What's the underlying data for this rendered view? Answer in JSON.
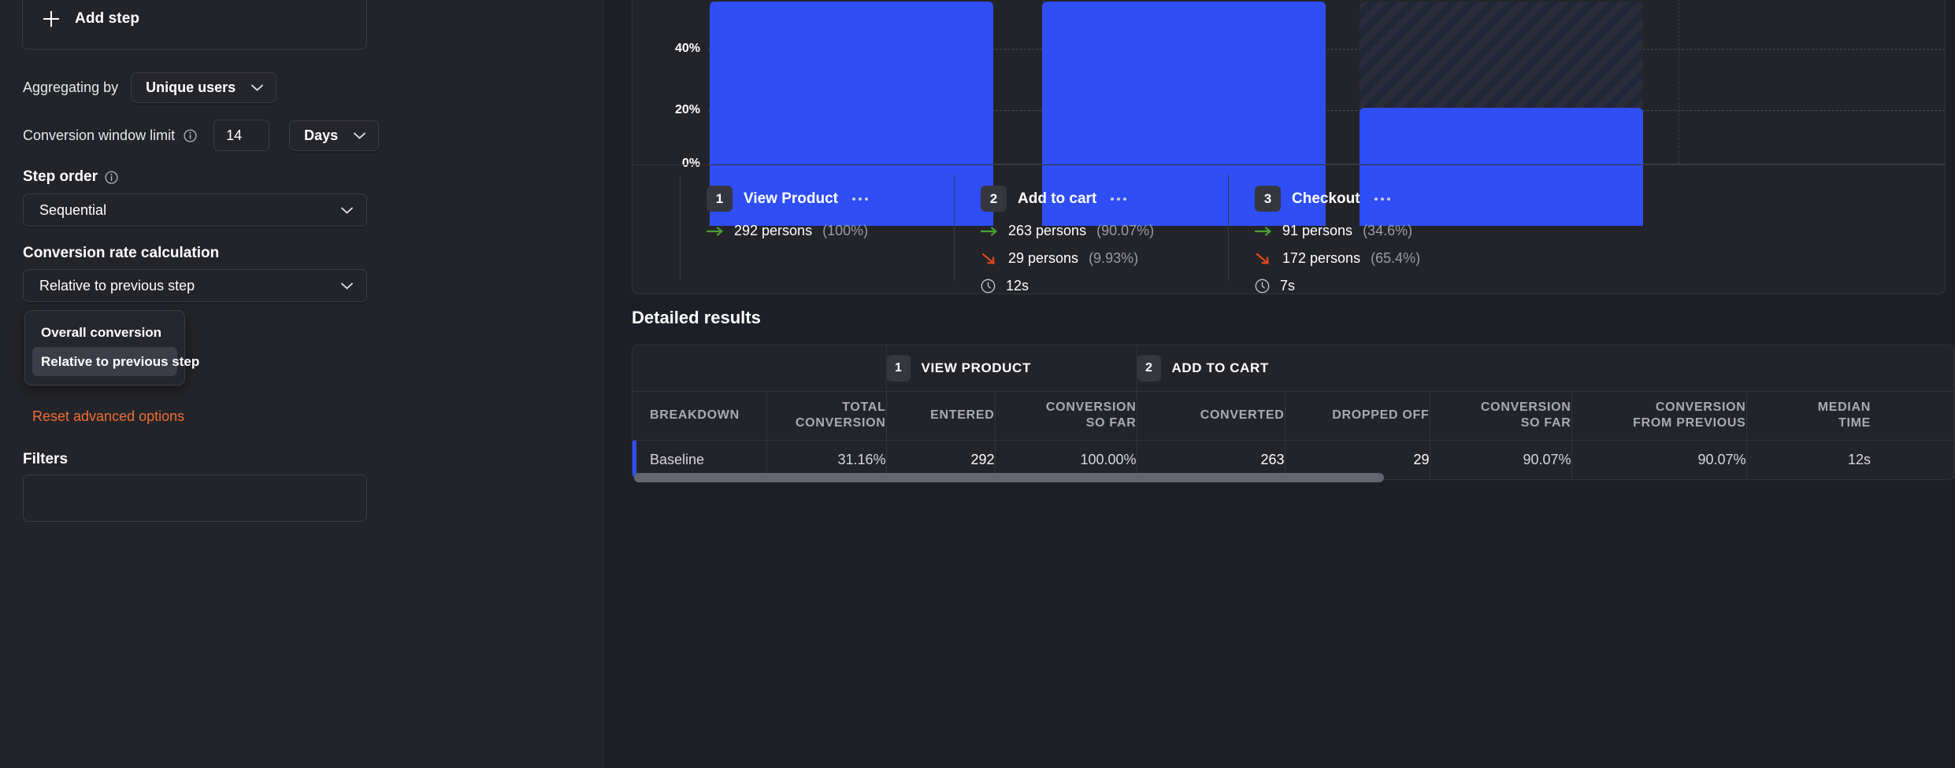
{
  "config_panel": {
    "add_step": {
      "label": "Add step",
      "icon": "plus-icon"
    },
    "aggregating": {
      "label": "Aggregating by",
      "value": "Unique users"
    },
    "conversion_window": {
      "label": "Conversion window limit",
      "value": "14",
      "unit": "Days",
      "info_icon": "info-icon"
    },
    "step_order": {
      "heading": "Step order",
      "value": "Sequential",
      "info_icon": "info-icon"
    },
    "conversion_rate": {
      "heading": "Conversion rate calculation",
      "value": "Relative to previous step",
      "options": [
        {
          "label": "Overall conversion",
          "selected": false
        },
        {
          "label": "Relative to previous step",
          "selected": true
        }
      ]
    },
    "reset_link": "Reset advanced options",
    "filters_heading": "Filters"
  },
  "funnel": {
    "y_ticks": [
      "40%",
      "20%",
      "0%"
    ],
    "steps": [
      {
        "index": "1",
        "name": "View Product",
        "converted": "292 persons",
        "converted_pct": "(100%)",
        "dropped": null,
        "dropped_pct": null,
        "median_time": null
      },
      {
        "index": "2",
        "name": "Add to cart",
        "converted": "263 persons",
        "converted_pct": "(90.07%)",
        "dropped": "29 persons",
        "dropped_pct": "(9.93%)",
        "median_time": "12s"
      },
      {
        "index": "3",
        "name": "Checkout",
        "converted": "91 persons",
        "converted_pct": "(34.6%)",
        "dropped": "172 persons",
        "dropped_pct": "(65.4%)",
        "median_time": "7s"
      }
    ]
  },
  "chart_data": {
    "type": "bar",
    "title": "",
    "xlabel": "",
    "ylabel": "",
    "categories": [
      "View Product",
      "Add to cart",
      "Checkout"
    ],
    "series": [
      {
        "name": "Converted",
        "values": [
          100,
          90.07,
          34.6
        ]
      },
      {
        "name": "Dropped off",
        "values": [
          0,
          9.93,
          65.4
        ]
      }
    ],
    "ylim": [
      0,
      50
    ],
    "yticks": [
      0,
      20,
      40
    ],
    "ytick_labels": [
      "0%",
      "20%",
      "40%"
    ],
    "grid": true,
    "legend": "none",
    "bar_color": "#2f4ef5",
    "dropped_pattern": "diagonal-hatch",
    "note": "Bars are clipped at top of viewport; visible y-axis shows 0%, 20%, 40%"
  },
  "detailed_results": {
    "title": "Detailed results",
    "step_groups": [
      {
        "index": "1",
        "label": "VIEW PRODUCT"
      },
      {
        "index": "2",
        "label": "ADD TO CART"
      }
    ],
    "columns": [
      "BREAKDOWN",
      "TOTAL\nCONVERSION",
      "ENTERED",
      "CONVERSION\nSO FAR",
      "CONVERTED",
      "DROPPED OFF",
      "CONVERSION\nSO FAR",
      "CONVERSION\nFROM PREVIOUS",
      "MEDIAN\nTIME"
    ],
    "column_labels": {
      "breakdown": "BREAKDOWN",
      "total_conversion_l1": "TOTAL",
      "total_conversion_l2": "CONVERSION",
      "entered": "ENTERED",
      "conv_so_far_l1": "CONVERSION",
      "conv_so_far_l2": "SO FAR",
      "converted": "CONVERTED",
      "dropped_off": "DROPPED OFF",
      "conv_so_far2_l1": "CONVERSION",
      "conv_so_far2_l2": "SO FAR",
      "conv_from_prev_l1": "CONVERSION",
      "conv_from_prev_l2": "FROM PREVIOUS",
      "median_time_l1": "MEDIAN",
      "median_time_l2": "TIME"
    },
    "rows": [
      {
        "breakdown": "Baseline",
        "total_conversion": "31.16%",
        "entered": "292",
        "conversion_so_far": "100.00%",
        "converted": "263",
        "dropped_off": "29",
        "conversion_so_far_2": "90.07%",
        "conversion_from_previous": "90.07%",
        "median_time": "12s"
      }
    ]
  },
  "colors": {
    "accent_blue": "#2f4ef5",
    "reset_orange": "#ef6e33",
    "arrow_green": "#4a9e2f",
    "arrow_red": "#e0481f",
    "panel_bg": "#232429",
    "page_bg": "#1d1f27"
  }
}
